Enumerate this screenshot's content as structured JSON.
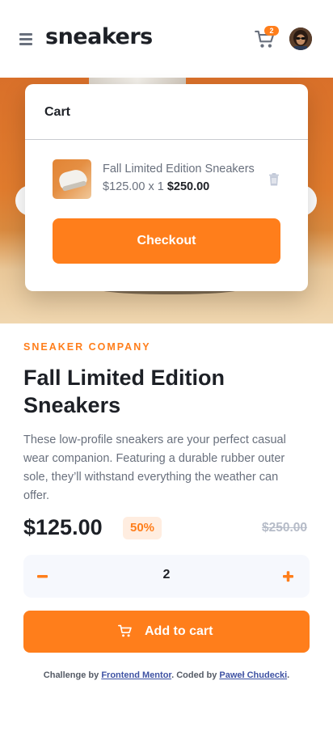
{
  "header": {
    "logo": "sneakers",
    "cart_count": "2"
  },
  "cart": {
    "title": "Cart",
    "item": {
      "name": "Fall Limited Edition Sneakers",
      "unit_price": "$125.00 x 1",
      "total": "$250.00"
    },
    "checkout_label": "Checkout"
  },
  "product": {
    "company": "SNEAKER COMPANY",
    "title": "Fall Limited Edition Sneakers",
    "description": "These low-profile sneakers are your perfect casual wear companion. Featuring a durable rubber outer sole, they’ll withstand everything the weather can offer.",
    "price": "$125.00",
    "discount": "50%",
    "old_price": "$250.00",
    "quantity": "2",
    "add_to_cart_label": "Add to cart"
  },
  "attribution": {
    "prefix": "Challenge by ",
    "link1": "Frontend Mentor",
    "middle": ". Coded by ",
    "link2": "Paweł Chudecki",
    "suffix": "."
  },
  "colors": {
    "accent": "#ff7e1b",
    "accent_light": "#ffede0",
    "text_dark": "#1d2026",
    "text_muted": "#69707d",
    "qty_bg": "#f6f8fd"
  },
  "icons": {
    "menu": "menu-icon",
    "cart": "cart-icon",
    "trash": "trash-icon",
    "minus": "minus-icon",
    "plus": "plus-icon",
    "prev": "chevron-left-icon",
    "next": "chevron-right-icon"
  }
}
